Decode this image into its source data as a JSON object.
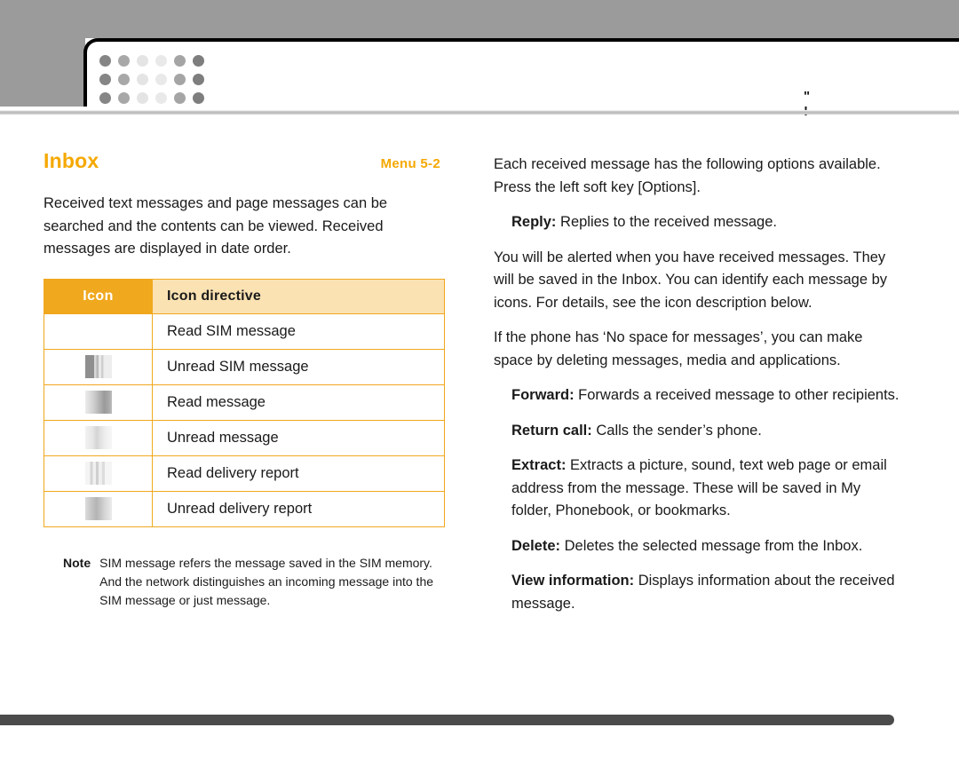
{
  "header": {
    "logo_name": "dot-matrix-logo",
    "dot_shades": [
      "#858585",
      "#a8a8a8",
      "#e4e4e4",
      "#e9e9e9",
      "#a5a5a5",
      "#7e7e7e",
      "#858585",
      "#a8a8a8",
      "#e4e4e4",
      "#e9e9e9",
      "#a5a5a5",
      "#7e7e7e",
      "#858585",
      "#a8a8a8",
      "#e4e4e4",
      "#e9e9e9",
      "#a5a5a5",
      "#7e7e7e"
    ],
    "marks": "\" !"
  },
  "section": {
    "title": "Inbox",
    "menu_ref": "Menu 5-2",
    "accent_color": "#f5a800"
  },
  "left": {
    "intro": "Received text messages and page messages can be searched and the contents can be viewed. Received messages are displayed in date order.",
    "table": {
      "headers": [
        "Icon",
        "Icon directive"
      ],
      "rows": [
        {
          "icon": "read-sim-message-icon",
          "glyph_class": "empty",
          "directive": "Read SIM message"
        },
        {
          "icon": "unread-sim-message-icon",
          "glyph_class": "g-unread-sim",
          "directive": "Unread SIM message"
        },
        {
          "icon": "read-message-icon",
          "glyph_class": "g-read",
          "directive": "Read message"
        },
        {
          "icon": "unread-message-icon",
          "glyph_class": "g-unread",
          "directive": "Unread message"
        },
        {
          "icon": "read-delivery-report-icon",
          "glyph_class": "g-read-delivery",
          "directive": "Read delivery report"
        },
        {
          "icon": "unread-delivery-report-icon",
          "glyph_class": "g-unread-delivery",
          "directive": "Unread delivery report"
        }
      ]
    },
    "note": {
      "label": "Note",
      "text": "SIM message refers the message saved in the SIM memory. And the network distinguishes an incoming message into the SIM message or just message."
    }
  },
  "right": {
    "paragraph_1": "Each received message has the following options available. Press the left soft key [Options].",
    "option_reply_label": "Reply:",
    "option_reply_text": " Replies to the received message.",
    "paragraph_2": "You will be alerted when you have received messages. They will be saved in the Inbox. You can identify each message by icons. For details, see the icon description below.",
    "paragraph_3": "If the phone has ‘No space for messages’, you can make space by deleting messages, media and applications.",
    "option_forward_label": "Forward:",
    "option_forward_text": " Forwards a received message to other recipients.",
    "option_return_call_label": "Return call:",
    "option_return_call_text": " Calls the sender’s phone.",
    "option_extract_label": "Extract:",
    "option_extract_text": " Extracts a picture, sound, text web page or email address from the message. These will be saved in My folder, Phonebook, or bookmarks.",
    "option_delete_label": "Delete:",
    "option_delete_text": " Deletes the selected message from the Inbox.",
    "option_view_info_label": "View information:",
    "option_view_info_text": " Displays information about the received message."
  }
}
